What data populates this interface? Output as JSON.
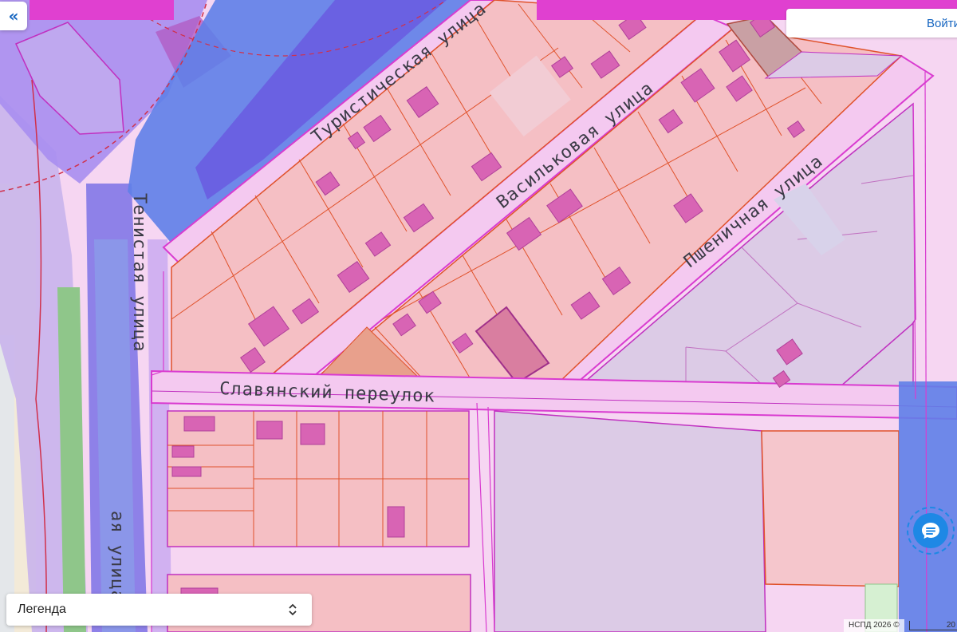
{
  "header": {
    "collapse_icon": "«",
    "login_label": "Войти"
  },
  "map": {
    "streets": {
      "turisticheskaya": "Туристическая улица",
      "vasilkovaya": "Васильковая улица",
      "pshenichnaya": "Пшеничная улица",
      "tenistaya": "Тенистая улица",
      "slavyansky": "Славянский переулок",
      "left_street_partial": "ая улица"
    },
    "colors": {
      "parcel_fill": "#f5bfc4",
      "parcel_line": "#e0522b",
      "zone_fill": "#f4c9f0",
      "zone_line": "#d93bd0",
      "building_fill": "#d864b4",
      "purple_zone": "#7b5be0",
      "blue_zone": "#5f7fe8",
      "green_strip": "#8fc68a",
      "gray_zone": "#dccbe6"
    }
  },
  "legend": {
    "label": "Легенда",
    "chevron_icon": "⌃⌄"
  },
  "chat": {
    "icon": "chat-bubble-icon"
  },
  "footer": {
    "copyright": "НСПД 2026 ©",
    "scale_label": "20"
  }
}
